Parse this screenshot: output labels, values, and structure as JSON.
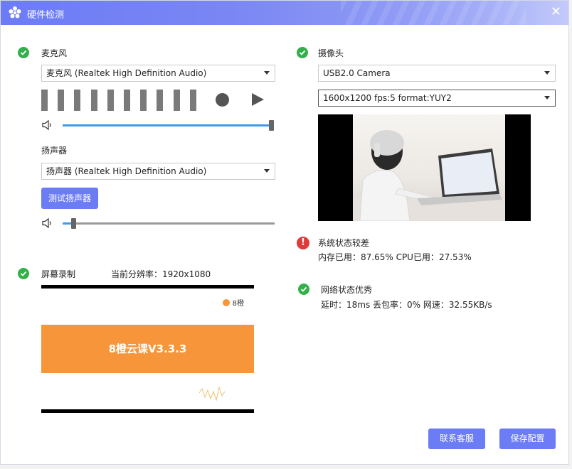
{
  "window": {
    "title": "硬件检测",
    "close_glyph": "✕"
  },
  "microphone": {
    "label": "麦克风",
    "device": "麦克风 (Realtek High Definition Audio)",
    "level_bars": 10,
    "volume_fraction": 1.0
  },
  "speaker": {
    "label": "扬声器",
    "device": "扬声器 (Realtek High Definition Audio)",
    "test_button": "测试扬声器",
    "volume_fraction": 0.05
  },
  "screen": {
    "label": "屏幕录制",
    "resolution_text": "当前分辨率：1920x1080",
    "preview_title": "8橙云课V3.3.3",
    "preview_logo_text": "8橙"
  },
  "camera": {
    "label": "摄像头",
    "device": "USB2.0 Camera",
    "format": "1600x1200 fps:5 format:YUY2"
  },
  "system": {
    "title": "系统状态较差",
    "detail": "内存已用：87.65%   CPU已用：27.53%"
  },
  "network": {
    "title": "网络状态优秀",
    "detail": "延时：18ms  丢包率：0%  网速：32.55KB/s"
  },
  "footer": {
    "support_button": "联系客服",
    "save_button": "保存配置"
  },
  "colors": {
    "accent": "#6b7cf5",
    "ok": "#33b04a",
    "error": "#e03b3b",
    "slider": "#3d9be9",
    "orange": "#f7953a"
  }
}
